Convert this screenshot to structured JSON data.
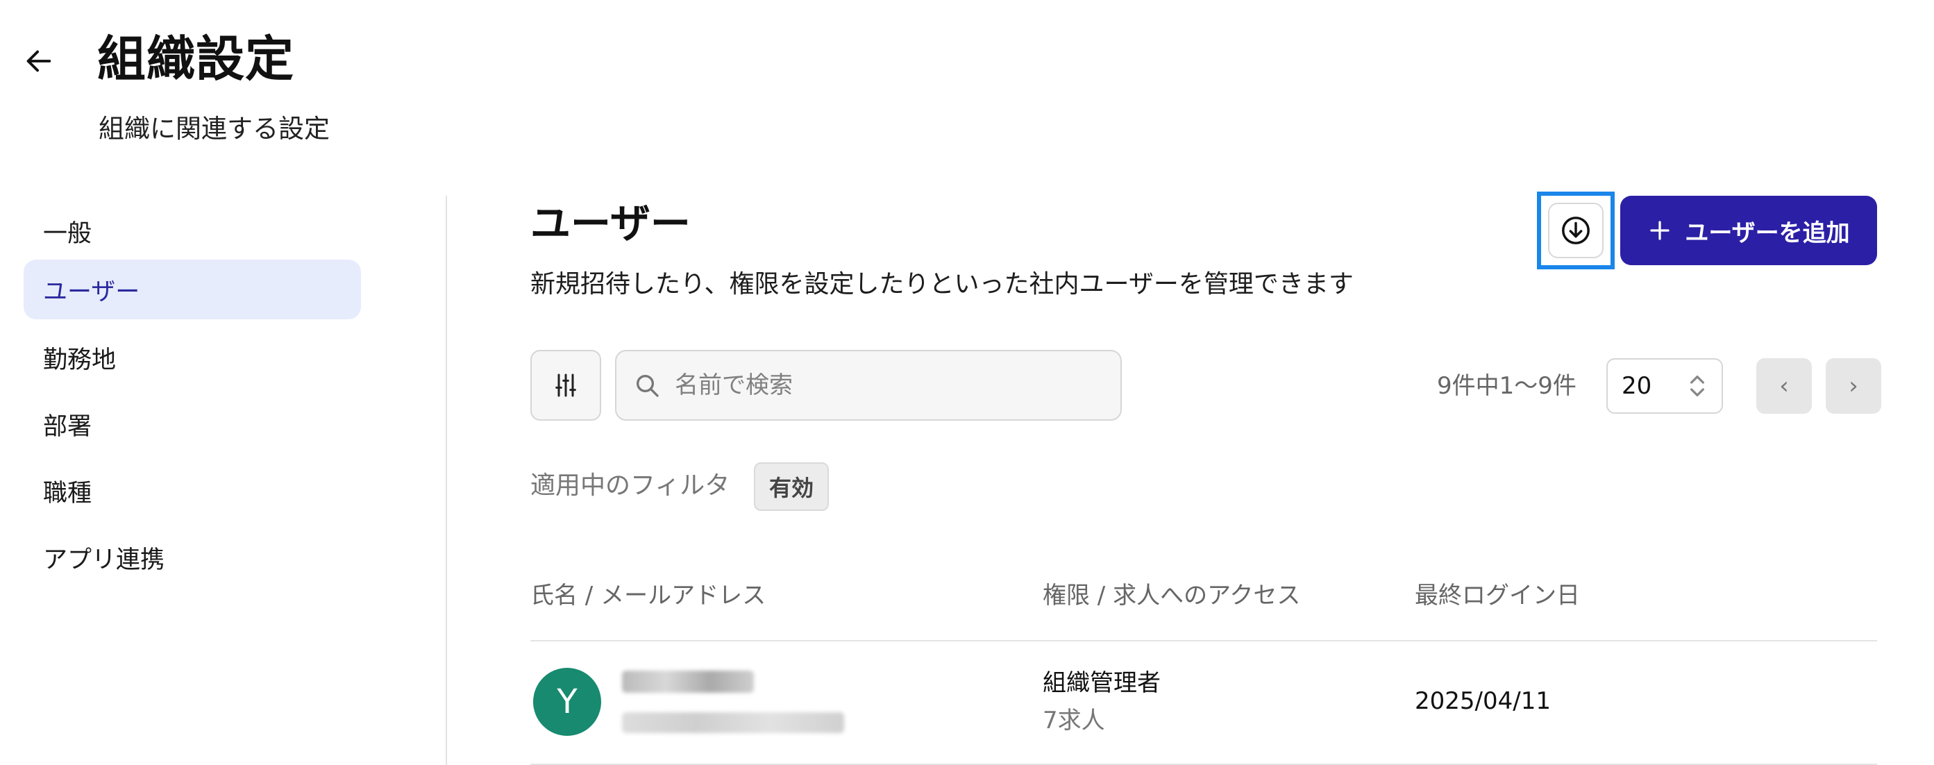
{
  "header": {
    "title": "組織設定",
    "subtitle": "組織に関連する設定",
    "back_icon": "arrow-left-icon"
  },
  "sidebar": {
    "items": [
      {
        "label": "一般",
        "active": false
      },
      {
        "label": "ユーザー",
        "active": true
      },
      {
        "label": "勤務地",
        "active": false
      },
      {
        "label": "部署",
        "active": false
      },
      {
        "label": "職種",
        "active": false
      },
      {
        "label": "アプリ連携",
        "active": false
      }
    ]
  },
  "main": {
    "title": "ユーザー",
    "description": "新規招待したり、権限を設定したりといった社内ユーザーを管理できます",
    "download_icon": "download-circle-icon",
    "add_button": {
      "icon": "plus-icon",
      "label": "ユーザーを追加"
    },
    "toolbar": {
      "filter_icon": "sliders-icon",
      "search_icon": "search-icon",
      "search_placeholder": "名前で検索",
      "pagination_text": "9件中1〜9件",
      "page_size": "20",
      "prev": "‹",
      "next": "›"
    },
    "applied_filters": {
      "label": "適用中のフィルタ",
      "chips": [
        "有効"
      ]
    },
    "table": {
      "headers": [
        "氏名 / メールアドレス",
        "権限 / 求人へのアクセス",
        "最終ログイン日"
      ],
      "rows": [
        {
          "avatar_letter": "Y",
          "role": "組織管理者",
          "jobs": "7求人",
          "last_login": "2025/04/11"
        }
      ]
    }
  },
  "colors": {
    "accent": "#2b1fa6",
    "active_bg": "#e6ecfb",
    "active_text": "#2b2a9f",
    "avatar_bg": "#178a6f",
    "highlight": "#1a86ea"
  }
}
